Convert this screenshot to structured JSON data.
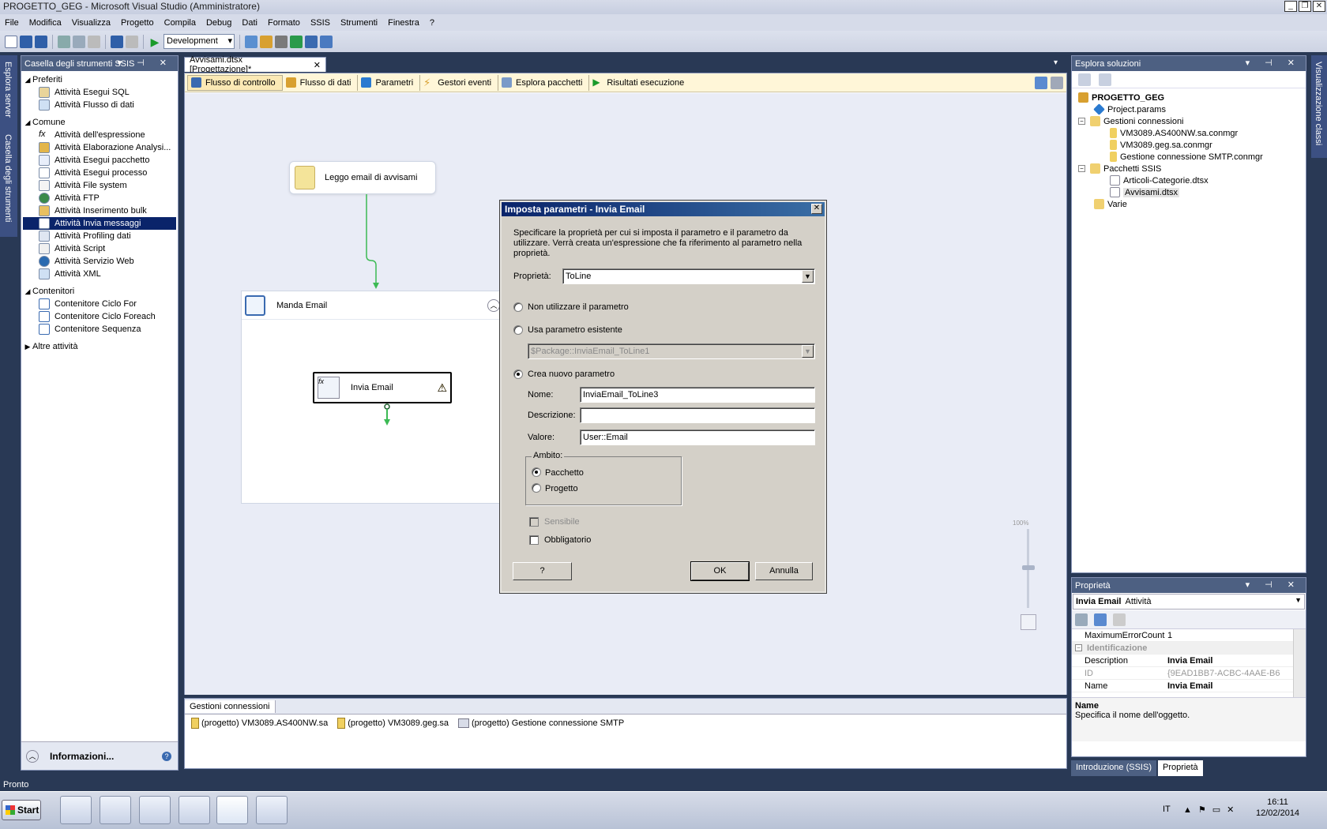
{
  "window": {
    "title": "PROGETTO_GEG - Microsoft Visual Studio (Amministratore)"
  },
  "menu": [
    "File",
    "Modifica",
    "Visualizza",
    "Progetto",
    "Compila",
    "Debug",
    "Dati",
    "Formato",
    "SSIS",
    "Strumenti",
    "Finestra",
    "?"
  ],
  "toolbar": {
    "configuration": "Development"
  },
  "side_strip": {
    "server_explorer": "Esplora server",
    "toolbox": "Casella degli strumenti"
  },
  "right_strip": {
    "class_view": "Visualizzazione classi"
  },
  "toolbox": {
    "title": "Casella degli strumenti SSIS",
    "categories": [
      {
        "name": "Preferiti",
        "items": [
          "Attività Esegui SQL",
          "Attività Flusso di dati"
        ]
      },
      {
        "name": "Comune",
        "items": [
          "Attività dell'espressione",
          "Attività Elaborazione Analysi...",
          "Attività Esegui pacchetto",
          "Attività Esegui processo",
          "Attività File system",
          "Attività FTP",
          "Attività Inserimento bulk",
          "Attività Invia messaggi",
          "Attività Profiling dati",
          "Attività Script",
          "Attività Servizio Web",
          "Attività XML"
        ]
      },
      {
        "name": "Contenitori",
        "items": [
          "Contenitore Ciclo For",
          "Contenitore Ciclo Foreach",
          "Contenitore Sequenza"
        ]
      },
      {
        "name": "Altre attività",
        "items": []
      }
    ],
    "selected": "Attività Invia messaggi",
    "info_label": "Informazioni..."
  },
  "document": {
    "tab": "Avvisami.dtsx [Progettazione]*",
    "design_tabs": [
      "Flusso di controllo",
      "Flusso di dati",
      "Parametri",
      "Gestori eventi",
      "Esplora pacchetti",
      "Risultati esecuzione"
    ],
    "nodes": {
      "read": "Leggo email di avvisami",
      "container": "Manda Email",
      "task": "Invia Email"
    },
    "zoom_label": "100%",
    "conn_tab": "Gestioni connessioni",
    "connections": [
      "(progetto) VM3089.AS400NW.sa",
      "(progetto) VM3089.geg.sa",
      "(progetto) Gestione connessione SMTP"
    ]
  },
  "dialog": {
    "title": "Imposta parametri - Invia Email",
    "intro": "Specificare la proprietà per cui si imposta il parametro e il parametro da utilizzare. Verrà creata un'espressione che fa riferimento al parametro nella proprietà.",
    "property_label": "Proprietà:",
    "property_value": "ToLine",
    "opt_none": "Non utilizzare il parametro",
    "opt_existing": "Usa parametro esistente",
    "existing_value": "$Package::InviaEmail_ToLine1",
    "opt_new": "Crea nuovo parametro",
    "name_label": "Nome:",
    "name_value": "InviaEmail_ToLine3",
    "desc_label": "Descrizione:",
    "desc_value": "",
    "value_label": "Valore:",
    "value_value": "User::Email",
    "scope_label": "Ambito:",
    "scope_package": "Pacchetto",
    "scope_project": "Progetto",
    "sensitive": "Sensibile",
    "required": "Obbligatorio",
    "help_btn": "?",
    "ok_btn": "OK",
    "cancel_btn": "Annulla"
  },
  "solution": {
    "title": "Esplora soluzioni",
    "project": "PROGETTO_GEG",
    "params": "Project.params",
    "conn_folder": "Gestioni connessioni",
    "conns": [
      "VM3089.AS400NW.sa.conmgr",
      "VM3089.geg.sa.conmgr",
      "Gestione connessione SMTP.conmgr"
    ],
    "pkg_folder": "Pacchetti SSIS",
    "packages": [
      "Articoli-Categorie.dtsx",
      "Avvisami.dtsx"
    ],
    "misc": "Varie"
  },
  "properties": {
    "title": "Proprietà",
    "object": "Invia Email",
    "object_type": "Attività",
    "rows": [
      {
        "k": "MaximumErrorCount",
        "v": "1"
      }
    ],
    "group": "Identificazione",
    "rows2": [
      {
        "k": "Description",
        "v": "Invia Email"
      },
      {
        "k": "ID",
        "v": "{9EAD1BB7-ACBC-4AAE-B6"
      },
      {
        "k": "Name",
        "v": "Invia Email"
      }
    ],
    "desc_title": "Name",
    "desc_text": "Specifica il nome dell'oggetto.",
    "bottom_tabs": [
      "Introduzione (SSIS)",
      "Proprietà"
    ]
  },
  "status": {
    "text": "Pronto"
  },
  "taskbar": {
    "start": "Start",
    "lang": "IT",
    "time": "16:11",
    "date": "12/02/2014"
  },
  "colors": {
    "vs_bg": "#293955",
    "canvas": "#e9ecf6",
    "selection": "#0a246a",
    "arrow": "#3cba54"
  }
}
